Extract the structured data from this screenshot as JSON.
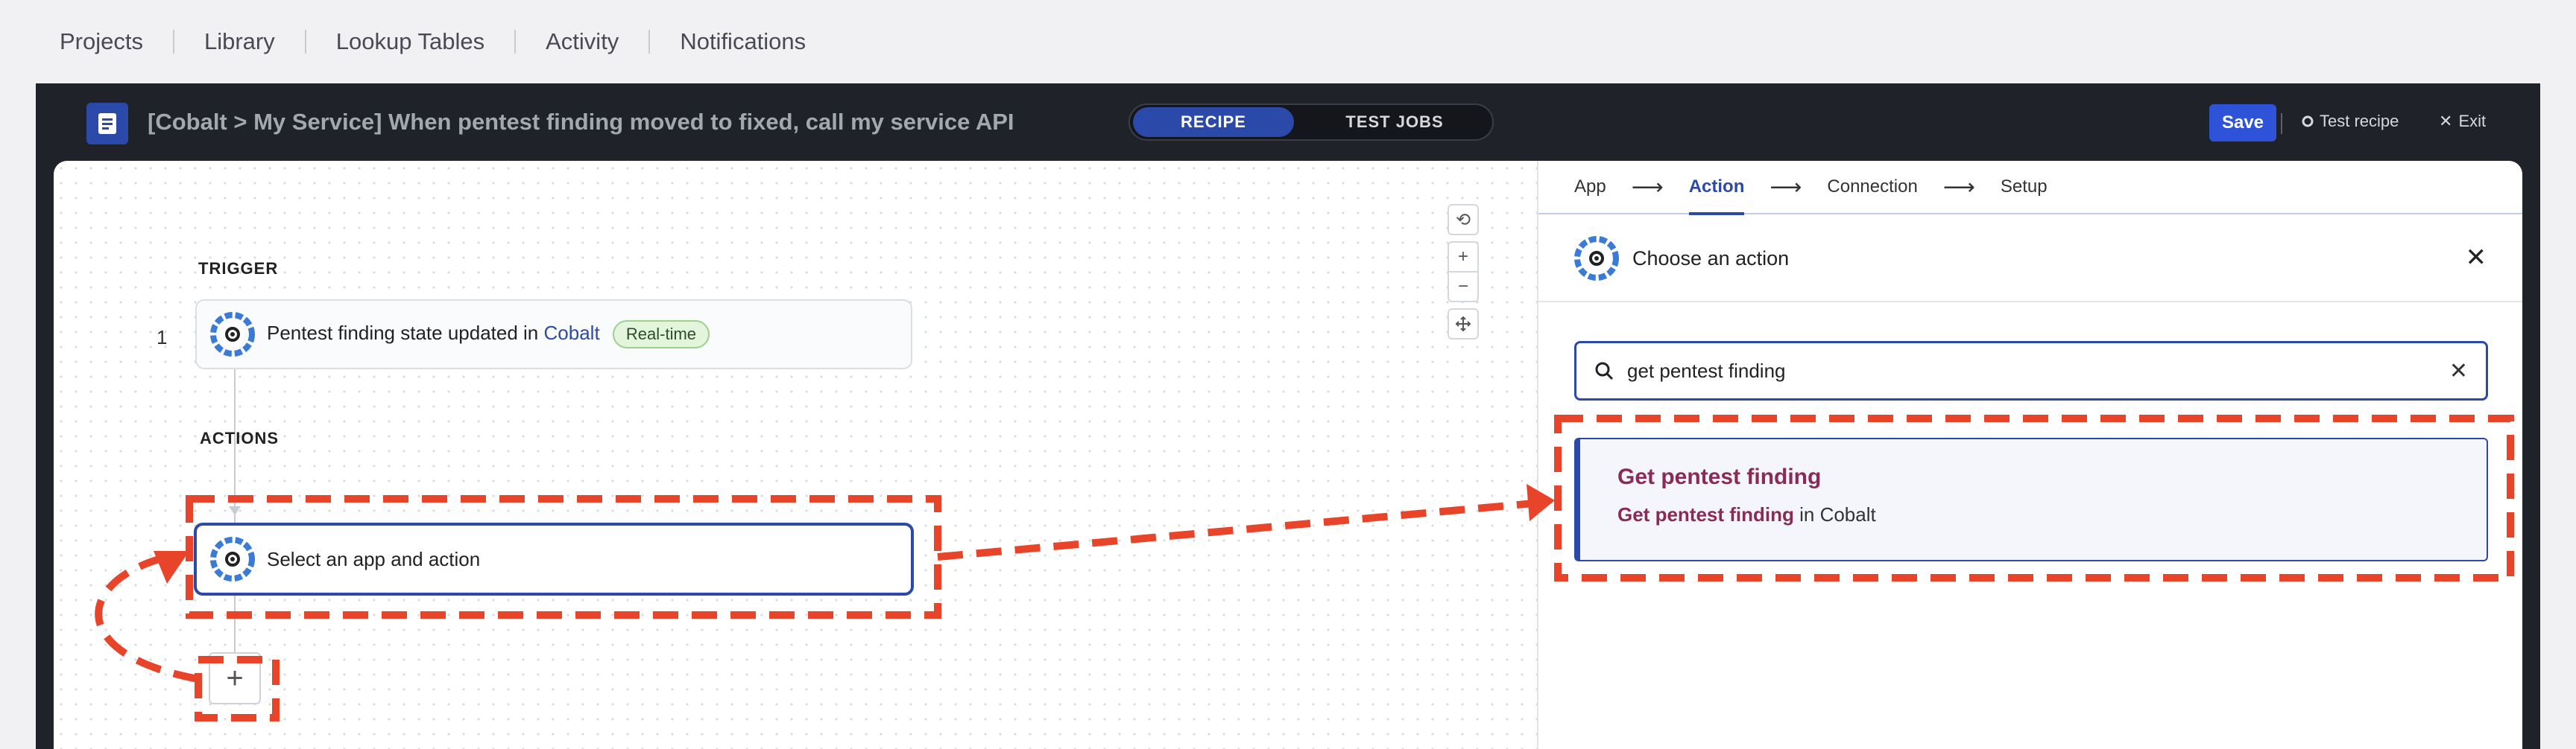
{
  "nav": {
    "items": [
      "Projects",
      "Library",
      "Lookup Tables",
      "Activity",
      "Notifications"
    ]
  },
  "titlebar": {
    "title": "[Cobalt > My Service] When pentest finding moved to fixed, call my service API",
    "mode_recipe": "RECIPE",
    "mode_test_jobs": "TEST JOBS",
    "save": "Save",
    "test_recipe": "Test recipe",
    "exit": "Exit"
  },
  "canvas": {
    "trigger_label": "TRIGGER",
    "actions_label": "ACTIONS",
    "trigger": {
      "step_number": "1",
      "text_before": "Pentest finding state updated in",
      "app_link": "Cobalt",
      "badge": "Real-time"
    },
    "action": {
      "text": "Select an app and action"
    }
  },
  "panel": {
    "crumbs": [
      "App",
      "Action",
      "Connection",
      "Setup"
    ],
    "active_crumb": "Action",
    "header": "Choose an action",
    "search_value": "get pentest finding",
    "result": {
      "title": "Get pentest finding",
      "sub_bold": "Get pentest finding",
      "sub_rest": " in Cobalt"
    }
  },
  "colors": {
    "accent": "#2b49a8",
    "annotation": "#e8442a",
    "result_text": "#8a2a57"
  },
  "icons": [
    "document-icon",
    "cobalt-logo-icon",
    "search-icon",
    "close-icon",
    "refresh-icon",
    "zoom-in-icon",
    "zoom-out-icon",
    "fit-view-icon",
    "plus-icon",
    "arrow-right-icon"
  ]
}
